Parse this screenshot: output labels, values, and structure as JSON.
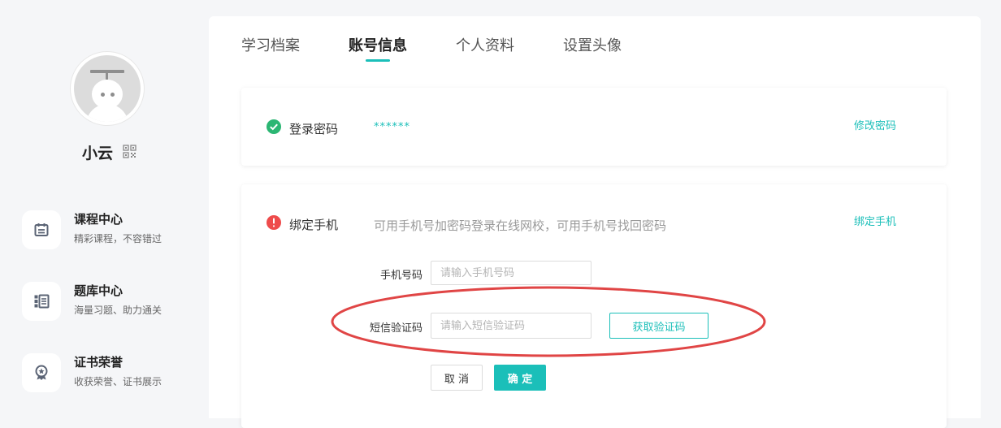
{
  "user": {
    "name": "小云"
  },
  "sidebar": {
    "items": [
      {
        "title": "课程中心",
        "subtitle": "精彩课程，不容错过",
        "icon": "calendar-icon"
      },
      {
        "title": "题库中心",
        "subtitle": "海量习题、助力通关",
        "icon": "list-icon"
      },
      {
        "title": "证书荣誉",
        "subtitle": "收获荣誉、证书展示",
        "icon": "award-icon"
      }
    ]
  },
  "tabs": [
    {
      "label": "学习档案",
      "active": false
    },
    {
      "label": "账号信息",
      "active": true
    },
    {
      "label": "个人资料",
      "active": false
    },
    {
      "label": "设置头像",
      "active": false
    }
  ],
  "password_card": {
    "label": "登录密码",
    "masked_value": "******",
    "action_label": "修改密码",
    "status": "set"
  },
  "phone_card": {
    "label": "绑定手机",
    "description": "可用手机号加密码登录在线网校，可用手机号找回密码",
    "action_label": "绑定手机",
    "status": "unbound",
    "phone_field": {
      "label": "手机号码",
      "placeholder": "请输入手机号码",
      "value": ""
    },
    "sms_field": {
      "label": "短信验证码",
      "placeholder": "请输入短信验证码",
      "value": ""
    },
    "get_code_label": "获取验证码",
    "cancel_label": "取 消",
    "confirm_label": "确 定"
  },
  "colors": {
    "accent": "#1bbfb9",
    "success": "#2bb673",
    "warning": "#ee4b4b",
    "annotation": "#e04545"
  }
}
